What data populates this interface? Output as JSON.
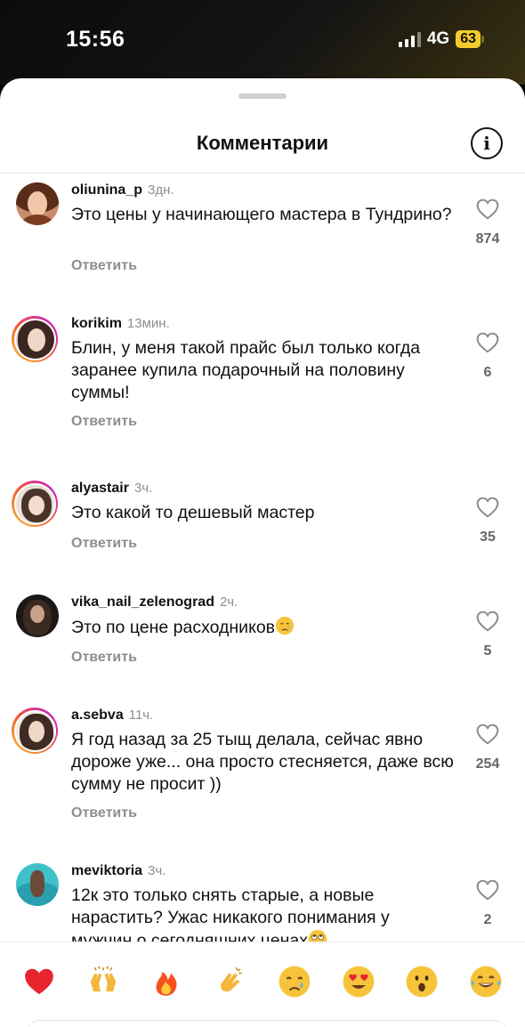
{
  "status_bar": {
    "time": "15:56",
    "network": "4G",
    "battery": "63"
  },
  "header": {
    "title": "Комментарии",
    "info_glyph": "i"
  },
  "reply_label": "Ответить",
  "comments": [
    {
      "username": "oliunina_p",
      "time": "3дн.",
      "text": "Это цены у начинающего мастера в Тундрино?",
      "likes": "874"
    },
    {
      "username": "korikim",
      "time": "13мин.",
      "text": "Блин, у меня такой прайс был только когда заранее купила подарочный на половину суммы!",
      "likes": "6"
    },
    {
      "username": "alyastair",
      "time": "3ч.",
      "text": "Это какой то дешевый мастер",
      "likes": "35"
    },
    {
      "username": "vika_nail_zelenograd",
      "time": "2ч.",
      "text": "Это по цене расходников",
      "text_emoji": "crying-face",
      "likes": "5"
    },
    {
      "username": "a.sebva",
      "time": "11ч.",
      "text": "Я год назад за 25 тыщ делала, сейчас явно дороже уже... она просто стесняется, даже всю сумму не просит ))",
      "likes": "254"
    },
    {
      "username": "meviktoria",
      "time": "3ч.",
      "text": "12к это только снять старые, а новые нарастить? Ужас никакого понимания у мужчин о сегодняшних ценах",
      "text_emoji": "rolling-eyes-face",
      "likes": "2"
    }
  ],
  "emoji_bar": [
    "red-heart",
    "raising-hands",
    "fire",
    "clapping-hands",
    "crying-face",
    "heart-eyes-face",
    "surprised-face",
    "tears-of-joy-face"
  ],
  "colors": {
    "accent_ring": "#d42ea0",
    "battery": "#f2cc2a",
    "muted_text": "#8e8e8e"
  }
}
